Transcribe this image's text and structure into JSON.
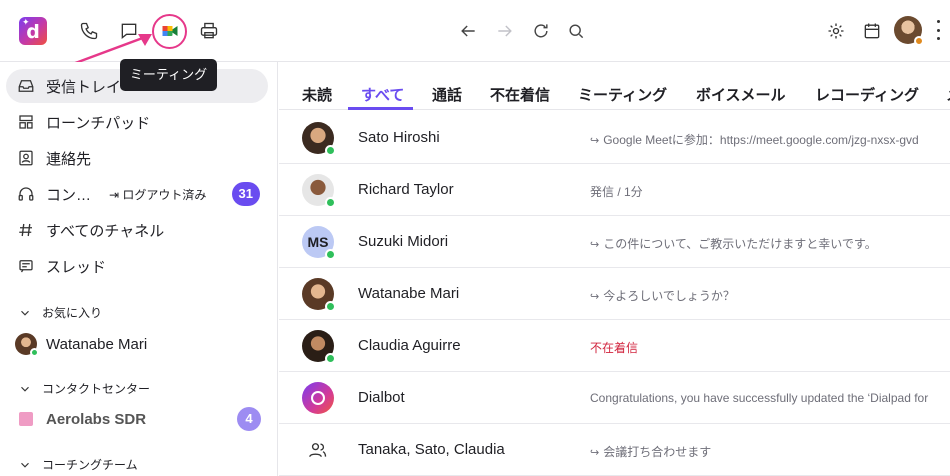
{
  "header": {
    "logo_letter": "d",
    "logo_sparkle": "✦",
    "tooltip": "ミーティング",
    "icons": [
      "phone-icon",
      "chat-icon",
      "google-meet-icon",
      "print-icon",
      "back-arrow-icon",
      "forward-arrow-icon",
      "refresh-icon",
      "search-icon",
      "gear-icon",
      "calendar-icon",
      "avatar",
      "more-icon"
    ]
  },
  "sidebar": {
    "items": [
      {
        "label": "受信トレイ"
      },
      {
        "label": "ローンチパッド"
      },
      {
        "label": "連絡先"
      },
      {
        "label": "コン…",
        "sub": "ログアウト済み",
        "badge": "31"
      },
      {
        "label": "すべてのチャネル"
      },
      {
        "label": "スレッド"
      }
    ],
    "favorites_label": "お気に入り",
    "favorite_contact": "Watanabe Mari",
    "contact_center_label": "コンタクトセンター",
    "contact_center_item": "Aerolabs SDR",
    "contact_center_badge": "4",
    "coaching_label": "コーチングチーム"
  },
  "tabs": [
    "未読",
    "すべて",
    "通話",
    "不在着信",
    "ミーティング",
    "ボイスメール",
    "レコーディング",
    "メ"
  ],
  "active_tab": "すべて",
  "rows": [
    {
      "name": "Sato Hiroshi",
      "reply": "↪",
      "message": "Google Meetに参加：https://meet.google.com/jzg-nxsx-gvd"
    },
    {
      "name": "Richard Taylor",
      "reply": "",
      "message": "発信 / 1分"
    },
    {
      "name": "Suzuki Midori",
      "initials": "MS",
      "reply": "↪",
      "message": "この件について、ご教示いただけますと幸いです。"
    },
    {
      "name": "Watanabe Mari",
      "reply": "↪",
      "message": "今よろしいでしょうか？"
    },
    {
      "name": "Claudia Aguirre",
      "reply": "",
      "message": "不在着信"
    },
    {
      "name": "Dialbot",
      "reply": "",
      "message": "Congratulations, you have successfully updated the ‘Dialpad for"
    },
    {
      "name": "Tanaka, Sato, Claudia",
      "reply": "↪",
      "message": "会議打ち合わせます"
    }
  ],
  "colors": {
    "accent": "#6a4cf0",
    "missed": "#d2263f",
    "online": "#2fbf5b",
    "highlight_ring": "#e6388a"
  }
}
